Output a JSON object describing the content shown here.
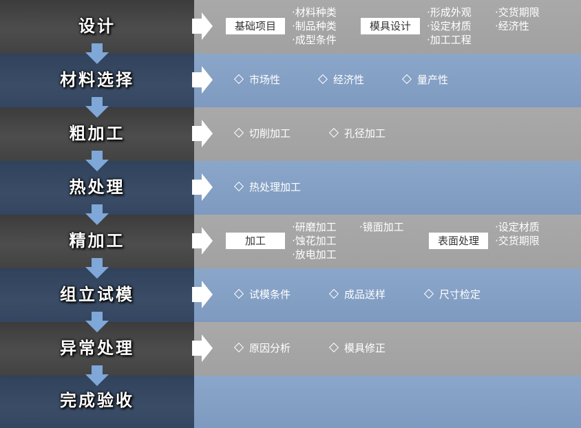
{
  "steps": [
    {
      "title": "设计"
    },
    {
      "title": "材料选择"
    },
    {
      "title": "粗加工"
    },
    {
      "title": "热处理"
    },
    {
      "title": "精加工"
    },
    {
      "title": "组立试模"
    },
    {
      "title": "异常处理"
    },
    {
      "title": "完成验收"
    }
  ],
  "design": {
    "box1": "基础项目",
    "box1_items": [
      "·材料种类",
      "·制品种类",
      "·成型条件"
    ],
    "box2": "模具设计",
    "box2_items": [
      "·形成外观",
      "·设定材质",
      "·加工工程"
    ],
    "box2_items_b": [
      "·交货期限",
      "·经济性"
    ]
  },
  "material": {
    "items": [
      "市场性",
      "经济性",
      "量产性"
    ]
  },
  "rough": {
    "items": [
      "切削加工",
      "孔径加工"
    ]
  },
  "heat": {
    "items": [
      "热处理加工"
    ]
  },
  "finish": {
    "box1": "加工",
    "box1_items": [
      "·研磨加工",
      "·蚀花加工",
      "·放电加工"
    ],
    "box1_items_b": [
      "·镜面加工"
    ],
    "box2": "表面处理",
    "box2_items": [
      "·设定材质",
      "·交货期限"
    ]
  },
  "trial": {
    "items": [
      "试模条件",
      "成品送样",
      "尺寸检定"
    ]
  },
  "abnormal": {
    "items": [
      "原因分析",
      "模具修正"
    ]
  },
  "colors": {
    "gray_dark": "#444444",
    "gray_light": "#a9a9a9",
    "blue_dark": "#35475f",
    "blue_light": "#87a2c6",
    "arrow": "#7fa7d8"
  }
}
